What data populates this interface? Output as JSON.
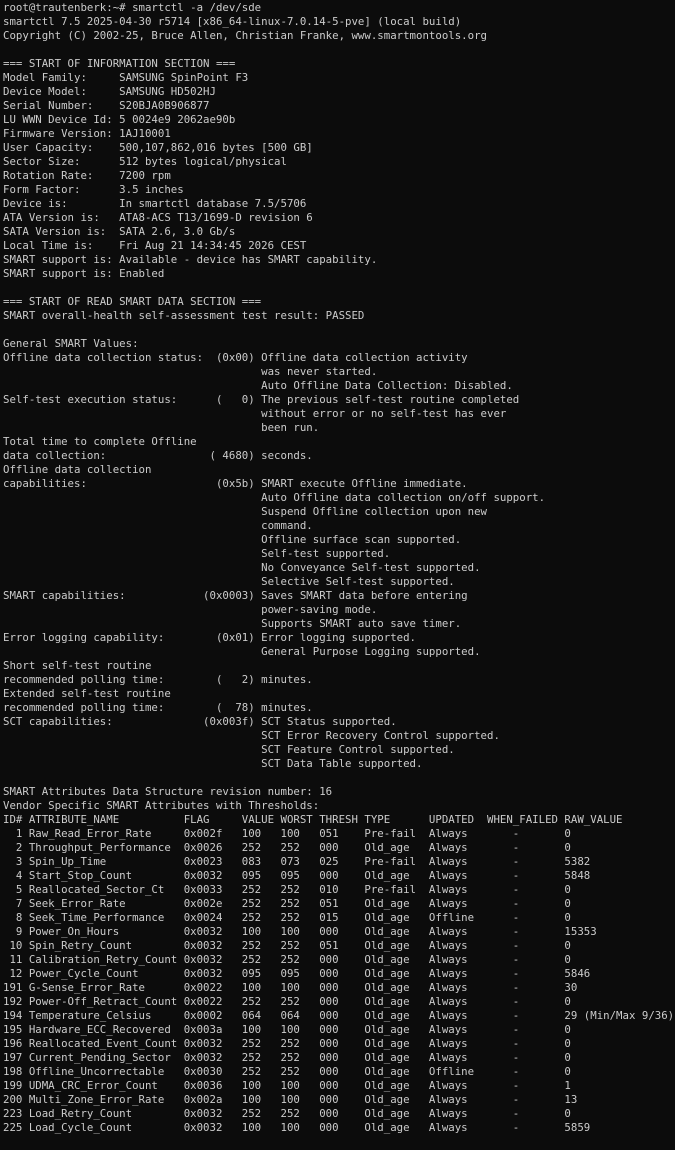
{
  "terminal": {
    "lines": [
      "root@trautenberk:~# smartctl -a /dev/sde",
      "smartctl 7.5 2025-04-30 r5714 [x86_64-linux-7.0.14-5-pve] (local build)",
      "Copyright (C) 2002-25, Bruce Allen, Christian Franke, www.smartmontools.org",
      "",
      "=== START OF INFORMATION SECTION ===",
      "Model Family:     SAMSUNG SpinPoint F3",
      "Device Model:     SAMSUNG HD502HJ",
      "Serial Number:    S20BJA0B906877",
      "LU WWN Device Id: 5 0024e9 2062ae90b",
      "Firmware Version: 1AJ10001",
      "User Capacity:    500,107,862,016 bytes [500 GB]",
      "Sector Size:      512 bytes logical/physical",
      "Rotation Rate:    7200 rpm",
      "Form Factor:      3.5 inches",
      "Device is:        In smartctl database 7.5/5706",
      "ATA Version is:   ATA8-ACS T13/1699-D revision 6",
      "SATA Version is:  SATA 2.6, 3.0 Gb/s",
      "Local Time is:    Fri Aug 21 14:34:45 2026 CEST",
      "SMART support is: Available - device has SMART capability.",
      "SMART support is: Enabled",
      "",
      "=== START OF READ SMART DATA SECTION ===",
      "SMART overall-health self-assessment test result: PASSED",
      "",
      "General SMART Values:",
      "Offline data collection status:  (0x00) Offline data collection activity",
      "                                        was never started.",
      "                                        Auto Offline Data Collection: Disabled.",
      "Self-test execution status:      (   0) The previous self-test routine completed",
      "                                        without error or no self-test has ever",
      "                                        been run.",
      "Total time to complete Offline",
      "data collection:                ( 4680) seconds.",
      "Offline data collection",
      "capabilities:                    (0x5b) SMART execute Offline immediate.",
      "                                        Auto Offline data collection on/off support.",
      "                                        Suspend Offline collection upon new",
      "                                        command.",
      "                                        Offline surface scan supported.",
      "                                        Self-test supported.",
      "                                        No Conveyance Self-test supported.",
      "                                        Selective Self-test supported.",
      "SMART capabilities:            (0x0003) Saves SMART data before entering",
      "                                        power-saving mode.",
      "                                        Supports SMART auto save timer.",
      "Error logging capability:        (0x01) Error logging supported.",
      "                                        General Purpose Logging supported.",
      "Short self-test routine",
      "recommended polling time:        (   2) minutes.",
      "Extended self-test routine",
      "recommended polling time:        (  78) minutes.",
      "SCT capabilities:              (0x003f) SCT Status supported.",
      "                                        SCT Error Recovery Control supported.",
      "                                        SCT Feature Control supported.",
      "                                        SCT Data Table supported.",
      "",
      "SMART Attributes Data Structure revision number: 16",
      "Vendor Specific SMART Attributes with Thresholds:",
      "ID# ATTRIBUTE_NAME          FLAG     VALUE WORST THRESH TYPE      UPDATED  WHEN_FAILED RAW_VALUE",
      "  1 Raw_Read_Error_Rate     0x002f   100   100   051    Pre-fail  Always       -       0",
      "  2 Throughput_Performance  0x0026   252   252   000    Old_age   Always       -       0",
      "  3 Spin_Up_Time            0x0023   083   073   025    Pre-fail  Always       -       5382",
      "  4 Start_Stop_Count        0x0032   095   095   000    Old_age   Always       -       5848",
      "  5 Reallocated_Sector_Ct   0x0033   252   252   010    Pre-fail  Always       -       0",
      "  7 Seek_Error_Rate         0x002e   252   252   051    Old_age   Always       -       0",
      "  8 Seek_Time_Performance   0x0024   252   252   015    Old_age   Offline      -       0",
      "  9 Power_On_Hours          0x0032   100   100   000    Old_age   Always       -       15353",
      " 10 Spin_Retry_Count        0x0032   252   252   051    Old_age   Always       -       0",
      " 11 Calibration_Retry_Count 0x0032   252   252   000    Old_age   Always       -       0",
      " 12 Power_Cycle_Count       0x0032   095   095   000    Old_age   Always       -       5846",
      "191 G-Sense_Error_Rate      0x0022   100   100   000    Old_age   Always       -       30",
      "192 Power-Off_Retract_Count 0x0022   252   252   000    Old_age   Always       -       0",
      "194 Temperature_Celsius     0x0002   064   064   000    Old_age   Always       -       29 (Min/Max 9/36)",
      "195 Hardware_ECC_Recovered  0x003a   100   100   000    Old_age   Always       -       0",
      "196 Reallocated_Event_Count 0x0032   252   252   000    Old_age   Always       -       0",
      "197 Current_Pending_Sector  0x0032   252   252   000    Old_age   Always       -       0",
      "198 Offline_Uncorrectable   0x0030   252   252   000    Old_age   Offline      -       0",
      "199 UDMA_CRC_Error_Count    0x0036   100   100   000    Old_age   Always       -       1",
      "200 Multi_Zone_Error_Rate   0x002a   100   100   000    Old_age   Always       -       13",
      "223 Load_Retry_Count        0x0032   252   252   000    Old_age   Always       -       0",
      "225 Load_Cycle_Count        0x0032   100   100   000    Old_age   Always       -       5859"
    ]
  },
  "colors": {
    "background": "#0c0c0c",
    "foreground": "#cccccc"
  }
}
